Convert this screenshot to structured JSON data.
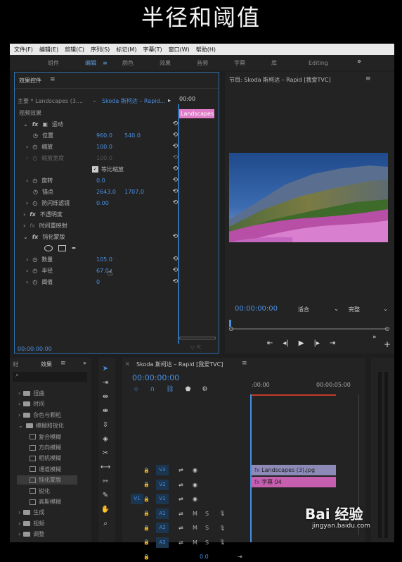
{
  "caption": "半径和阈值",
  "menu": [
    "文件(F)",
    "编辑(E)",
    "剪辑(C)",
    "序列(S)",
    "标记(M)",
    "字幕(T)",
    "窗口(W)",
    "帮助(H)"
  ],
  "workspaces": [
    "组件",
    "编辑",
    "颜色",
    "效果",
    "音频",
    "字幕",
    "库",
    "Editing"
  ],
  "workspace_more": "»",
  "effect_controls": {
    "title": "效果控件",
    "master": "主要 * Landscapes (3....",
    "sequence": "Skoda 斯柯达 – Rapid...",
    "tc_start": "00:00",
    "clip_label": "Landscapes",
    "video_effects": "视频效果",
    "motion": "运动",
    "position": "位置",
    "position_x": "960.0",
    "position_y": "540.0",
    "scale": "缩放",
    "scale_val": "100.0",
    "scale_width": "缩放宽度",
    "scale_width_val": "100.0",
    "uniform_scale": "等比缩放",
    "rotation": "旋转",
    "rotation_val": "0.0",
    "anchor": "锚点",
    "anchor_x": "2643.0",
    "anchor_y": "1707.0",
    "antiflicker": "防闪烁滤镜",
    "antiflicker_val": "0.00",
    "opacity": "不透明度",
    "time_remap": "时间重映射",
    "effect_name": "钝化蒙版",
    "amount": "数量",
    "amount_val": "105.0",
    "radius": "半径",
    "radius_val": "67.0",
    "threshold": "阈值",
    "threshold_val": "0",
    "timecode": "00:00:00:00"
  },
  "program": {
    "title": "节目: Skoda 斯柯达 – Rapid [我爱TVC]",
    "timecode": "00:00:00:00",
    "fit": "适合",
    "quality": "完整"
  },
  "effects_panel": {
    "tab_prev": "材",
    "title": "效果",
    "more": "»",
    "items": [
      "扭曲",
      "时间",
      "杂色与颗粒",
      "模糊和锐化",
      "复合模糊",
      "方向模糊",
      "相机模糊",
      "通道模糊",
      "钝化蒙版",
      "锐化",
      "高斯模糊",
      "生成",
      "视频",
      "调整"
    ]
  },
  "timeline": {
    "title": "Skoda 斯柯达 – Rapid [我爱TVC]",
    "timecode": "00:00:00:00",
    "ruler": [
      ":00:00",
      "00:00:05:00"
    ],
    "tracks": [
      "V3",
      "V2",
      "V1",
      "A1",
      "A2",
      "A3"
    ],
    "source_v": "V1",
    "clip_video": "Landscapes (3).jpg",
    "clip_title": "字幕 04",
    "m_label": "M",
    "s_label": "S",
    "master_val": "0.0"
  },
  "watermark": {
    "brand": "Bai 经验",
    "url": "jingyan.baidu.com"
  }
}
